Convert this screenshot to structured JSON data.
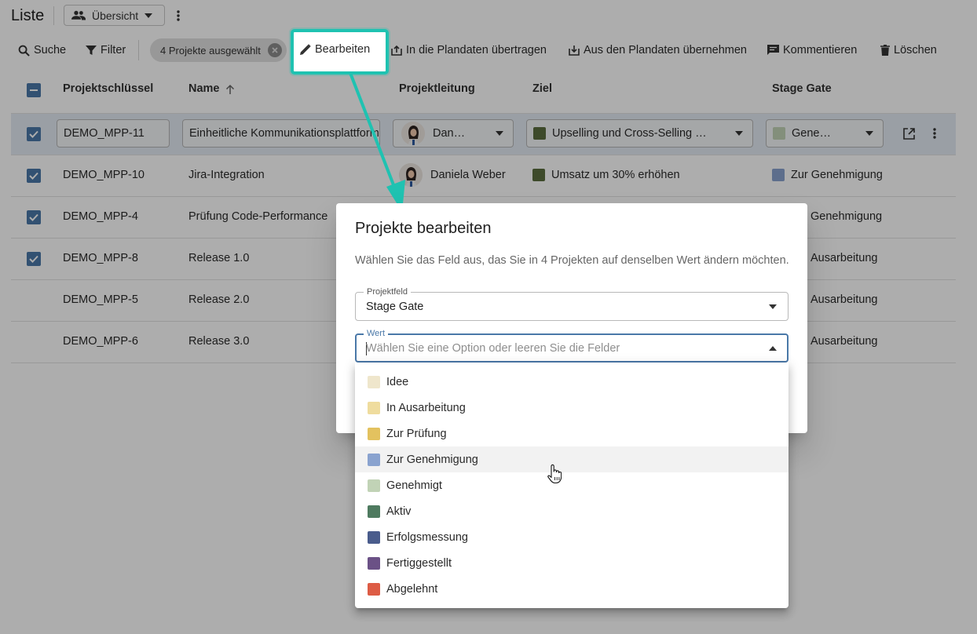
{
  "header": {
    "title": "Liste",
    "view_select": "Übersicht"
  },
  "toolbar": {
    "search": "Suche",
    "filter": "Filter",
    "selected_chip": "4 Projekte ausgewählt",
    "edit": "Bearbeiten",
    "transfer_to_plan": "In die Plandaten übertragen",
    "take_from_plan": "Aus den Plandaten übernehmen",
    "comment": "Kommentieren",
    "delete": "Löschen"
  },
  "table": {
    "columns": {
      "key": "Projektschlüssel",
      "name": "Name",
      "lead": "Projektleitung",
      "goal": "Ziel",
      "stage": "Stage Gate"
    },
    "rows": [
      {
        "key": "DEMO_MPP-11",
        "name": "Einheitliche Kommunikationsplattform",
        "lead": "Dan…",
        "goal": "Upselling und Cross-Selling …",
        "goal_color": "#5b6e3e",
        "stage": "Gene…",
        "stage_color": "#c1d3b6",
        "checked": true,
        "editing": true
      },
      {
        "key": "DEMO_MPP-10",
        "name": "Jira-Integration",
        "lead": "Daniela Weber",
        "goal": "Umsatz um 30% erhöhen",
        "goal_color": "#5b6e3e",
        "stage": "Zur Genehmigung",
        "stage_color": "#8aa3cf",
        "checked": true
      },
      {
        "key": "DEMO_MPP-4",
        "name": "Prüfung Code-Performance",
        "stage": "Genehmigung",
        "checked": true
      },
      {
        "key": "DEMO_MPP-8",
        "name": "Release 1.0",
        "stage": "Ausarbeitung",
        "checked": true
      },
      {
        "key": "DEMO_MPP-5",
        "name": "Release 2.0",
        "stage": "Ausarbeitung",
        "checked": false
      },
      {
        "key": "DEMO_MPP-6",
        "name": "Release 3.0",
        "stage": "Ausarbeitung",
        "checked": false
      }
    ]
  },
  "dialog": {
    "title": "Projekte bearbeiten",
    "description": "Wählen Sie das Feld aus, das Sie in 4 Projekten auf denselben Wert ändern möchten.",
    "field_label": "Projektfeld",
    "field_value": "Stage Gate",
    "value_label": "Wert",
    "value_placeholder": "Wählen Sie eine Option oder leeren Sie die Felder"
  },
  "options": [
    {
      "label": "Idee",
      "color": "#efe6cc"
    },
    {
      "label": "In Ausarbeitung",
      "color": "#efdc9e"
    },
    {
      "label": "Zur Prüfung",
      "color": "#e3c25f"
    },
    {
      "label": "Zur Genehmigung",
      "color": "#8aa3cf",
      "hovered": true
    },
    {
      "label": "Genehmigt",
      "color": "#c1d3b6"
    },
    {
      "label": "Aktiv",
      "color": "#4e7a5f"
    },
    {
      "label": "Erfolgsmessung",
      "color": "#4a5c8c"
    },
    {
      "label": "Fertiggestellt",
      "color": "#6b5186"
    },
    {
      "label": "Abgelehnt",
      "color": "#dd5c45"
    }
  ],
  "colors": {
    "accent": "#4a78a8",
    "callout": "#1fc2b1",
    "overlay": "rgba(0,0,0,0.32)"
  },
  "icons": [
    "people-icon",
    "chevron-down-icon",
    "more-vert-icon",
    "search-icon",
    "filter-icon",
    "clear-icon",
    "pencil-icon",
    "upload-box-icon",
    "download-box-icon",
    "comment-icon",
    "trash-icon",
    "arrow-up-icon",
    "check-icon",
    "minus-icon",
    "open-in-new-icon",
    "hand-cursor-icon"
  ]
}
